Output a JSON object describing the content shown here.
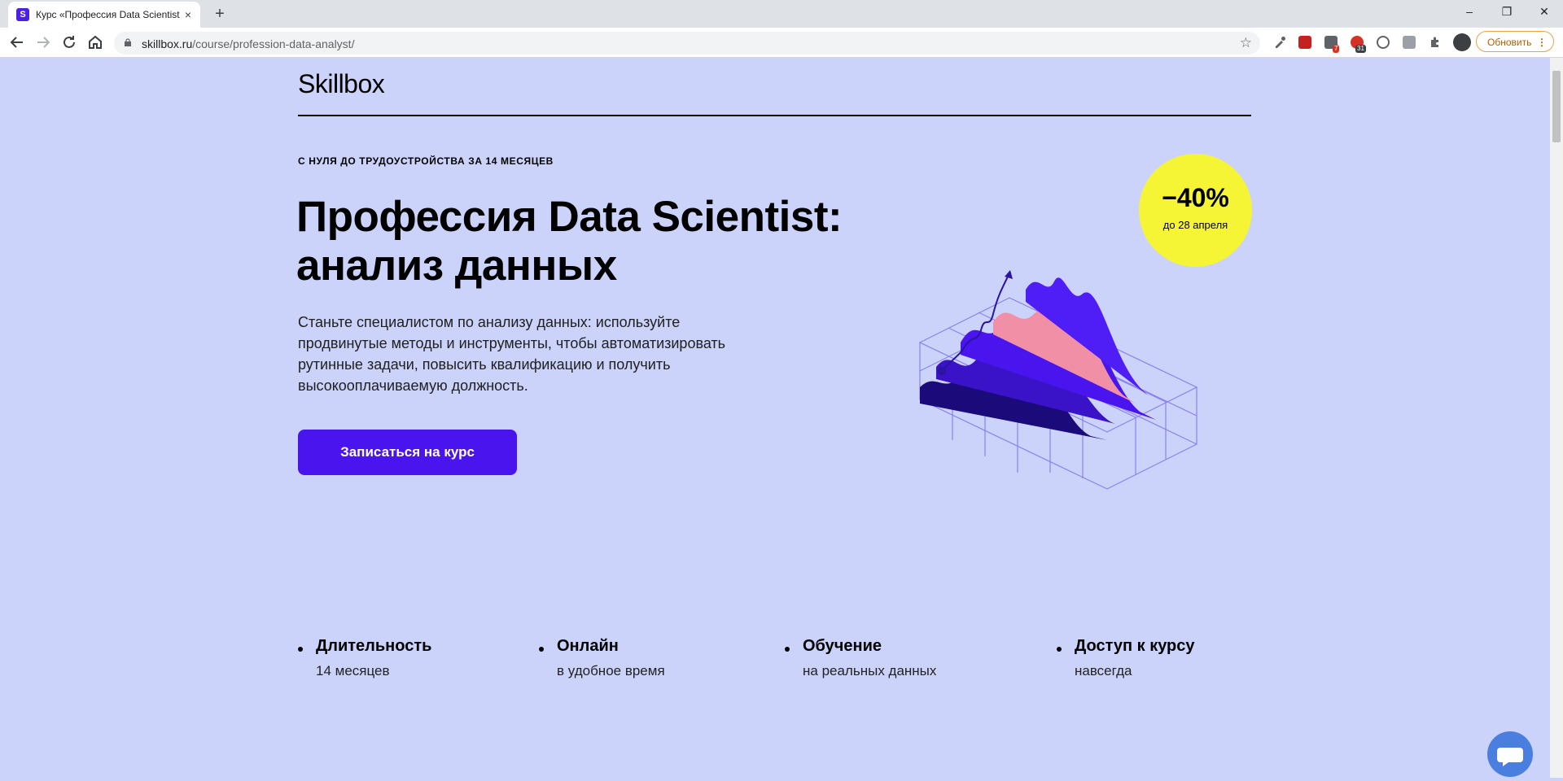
{
  "browser": {
    "tab": {
      "favicon": "S",
      "title": "Курс «Профессия Data Scientist",
      "close": "×"
    },
    "new_tab": "+",
    "window": {
      "minimize": "–",
      "restore": "❐",
      "close": "✕"
    },
    "url_domain": "skillbox.ru",
    "url_path": "/course/profession-data-analyst/",
    "update_label": "Обновить",
    "extensions": [
      {
        "name": "eyedropper-icon",
        "color": "#5f6368"
      },
      {
        "name": "pdf-icon",
        "color": "#c5221f"
      },
      {
        "name": "calendar-icon",
        "color": "#5f6368",
        "badge": "7"
      },
      {
        "name": "notification-icon",
        "color": "#d93025",
        "badge": "31"
      },
      {
        "name": "circle-extension-icon",
        "color": "#5f6368"
      },
      {
        "name": "image-extension-icon",
        "color": "#5f6368"
      },
      {
        "name": "puzzle-icon",
        "color": "#5f6368"
      },
      {
        "name": "profile-avatar",
        "color": "#3c4043"
      }
    ]
  },
  "page": {
    "logo": "Skillbox",
    "kicker": "С НУЛЯ ДО ТРУДОУСТРОЙСТВА ЗА 14 МЕСЯЦЕВ",
    "title": "Профессия Data Scientist: анализ данных",
    "description": "Станьте специалистом по анализу данных: используйте продвинутые методы и инструменты, чтобы автоматизировать рутинные задачи, повысить квалификацию и получить высокооплачиваемую должность.",
    "cta": "Записаться на курс",
    "badge": {
      "value": "−40%",
      "note": "до 28 апреля"
    },
    "features": [
      {
        "title": "Длительность",
        "sub": "14 месяцев"
      },
      {
        "title": "Онлайн",
        "sub": "в удобное время"
      },
      {
        "title": "Обучение",
        "sub": "на реальных данных"
      },
      {
        "title": "Доступ к курсу",
        "sub": "навсегда"
      }
    ],
    "colors": {
      "background": "#ccd3fb",
      "accent": "#4a14ee",
      "badge": "#f5f535",
      "pink": "#f08fa6"
    }
  }
}
